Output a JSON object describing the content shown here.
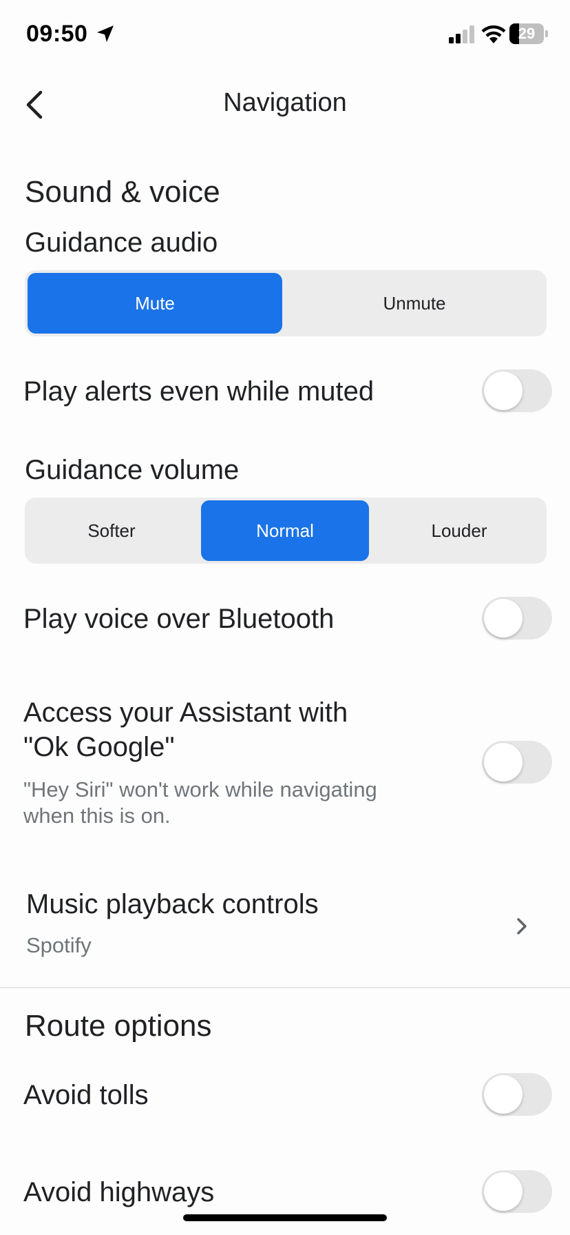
{
  "status_bar": {
    "time": "09:50",
    "battery": "29",
    "location_icon": "location-arrow-icon",
    "signal_icon": "cellular-signal-icon",
    "wifi_icon": "wifi-icon",
    "battery_icon": "battery-icon"
  },
  "header": {
    "title": "Navigation",
    "back_icon": "chevron-left-icon"
  },
  "sound_voice": {
    "section_title": "Sound & voice",
    "guidance_audio": {
      "label": "Guidance audio",
      "options": [
        "Mute",
        "Unmute"
      ],
      "selected": "Mute"
    },
    "play_alerts_muted": {
      "label": "Play alerts even while muted",
      "enabled": false
    },
    "guidance_volume": {
      "label": "Guidance volume",
      "options": [
        "Softer",
        "Normal",
        "Louder"
      ],
      "selected": "Normal"
    },
    "play_voice_bluetooth": {
      "label": "Play voice over Bluetooth",
      "enabled": false
    },
    "ok_google": {
      "label_line1": "Access your Assistant with",
      "label_line2": "\"Ok Google\"",
      "desc_line1": "\"Hey Siri\" won't work while navigating",
      "desc_line2": "when this is on.",
      "enabled": false
    },
    "music_playback": {
      "label": "Music playback controls",
      "value": "Spotify",
      "chevron_icon": "chevron-right-icon"
    }
  },
  "route_options": {
    "section_title": "Route options",
    "avoid_tolls": {
      "label": "Avoid tolls",
      "enabled": false
    },
    "avoid_highways": {
      "label": "Avoid highways",
      "enabled": false
    }
  },
  "colors": {
    "accent": "#1a73e8",
    "segment_bg": "#ececec",
    "toggle_off": "#e6e6e6",
    "secondary_text": "#70757a"
  }
}
